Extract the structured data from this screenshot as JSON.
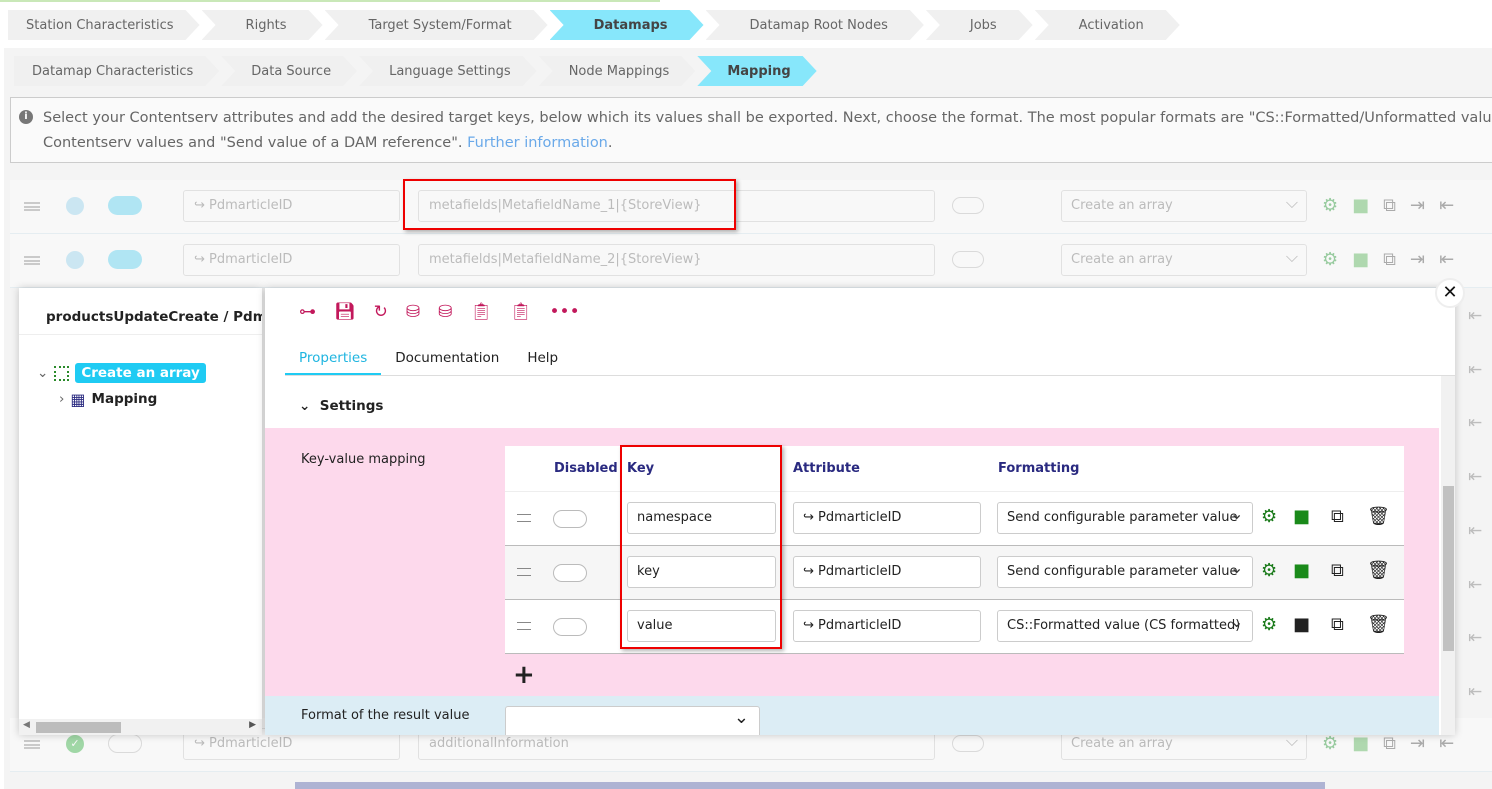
{
  "top_nav": [
    "Station Characteristics",
    "Rights",
    "Target System/Format",
    "Datamaps",
    "Datamap Root Nodes",
    "Jobs",
    "Activation"
  ],
  "top_nav_active": "Datamaps",
  "sub_nav": [
    "Datamap Characteristics",
    "Data Source",
    "Language Settings",
    "Node Mappings",
    "Mapping"
  ],
  "sub_nav_active": "Mapping",
  "info": {
    "text1": "Select your Contentserv attributes and add the desired target keys, below which its values shall be exported. Next, choose the format. The most popular formats are \"CS::Formatted/Unformatted value\" for the",
    "text2": "Contentserv values and \"Send value of a DAM reference\". ",
    "link": "Further information",
    "end": "."
  },
  "background_rows": [
    {
      "attribute": "PdmarticleID",
      "key": "metafields|MetafieldName_1|{StoreView}",
      "format": "Create an array"
    },
    {
      "attribute": "PdmarticleID",
      "key": "metafields|MetafieldName_2|{StoreView}",
      "format": "Create an array"
    },
    {
      "attribute": "PdmarticleID",
      "key": "additionalInformation",
      "format": "Create an array"
    }
  ],
  "modal": {
    "title": "productsUpdateCreate / PdmarticleID",
    "tree": [
      {
        "label": "Create an array",
        "selected": true
      },
      {
        "label": "Mapping"
      }
    ],
    "toolbar_icons": [
      "tree-icon",
      "save-icon",
      "undo-icon",
      "db-export-icon",
      "db-info-icon",
      "clipboard-c-icon",
      "clipboard-p-icon",
      "more-icon"
    ],
    "tabs": [
      "Properties",
      "Documentation",
      "Help"
    ],
    "active_tab": "Properties",
    "section": "Settings",
    "kv_label": "Key-value mapping",
    "columns": [
      "Disabled",
      "Key",
      "Attribute",
      "Formatting"
    ],
    "rows": [
      {
        "key": "namespace",
        "attribute": "PdmarticleID",
        "formatting": "Send configurable parameter value",
        "note_color": "#1a8a1a"
      },
      {
        "key": "key",
        "attribute": "PdmarticleID",
        "formatting": "Send configurable parameter value",
        "note_color": "#1a8a1a"
      },
      {
        "key": "value",
        "attribute": "PdmarticleID",
        "formatting": "CS::Formatted value (CS formatted)",
        "note_color": "#222222"
      }
    ],
    "add": "+",
    "format_label": "Format of the result value",
    "close": "✕"
  },
  "colors": {
    "accent": "#87e7fb",
    "highlight": "#e00000",
    "pink": "#fdd9ec",
    "blue": "#dcedf5",
    "icon": "#c2185b"
  }
}
